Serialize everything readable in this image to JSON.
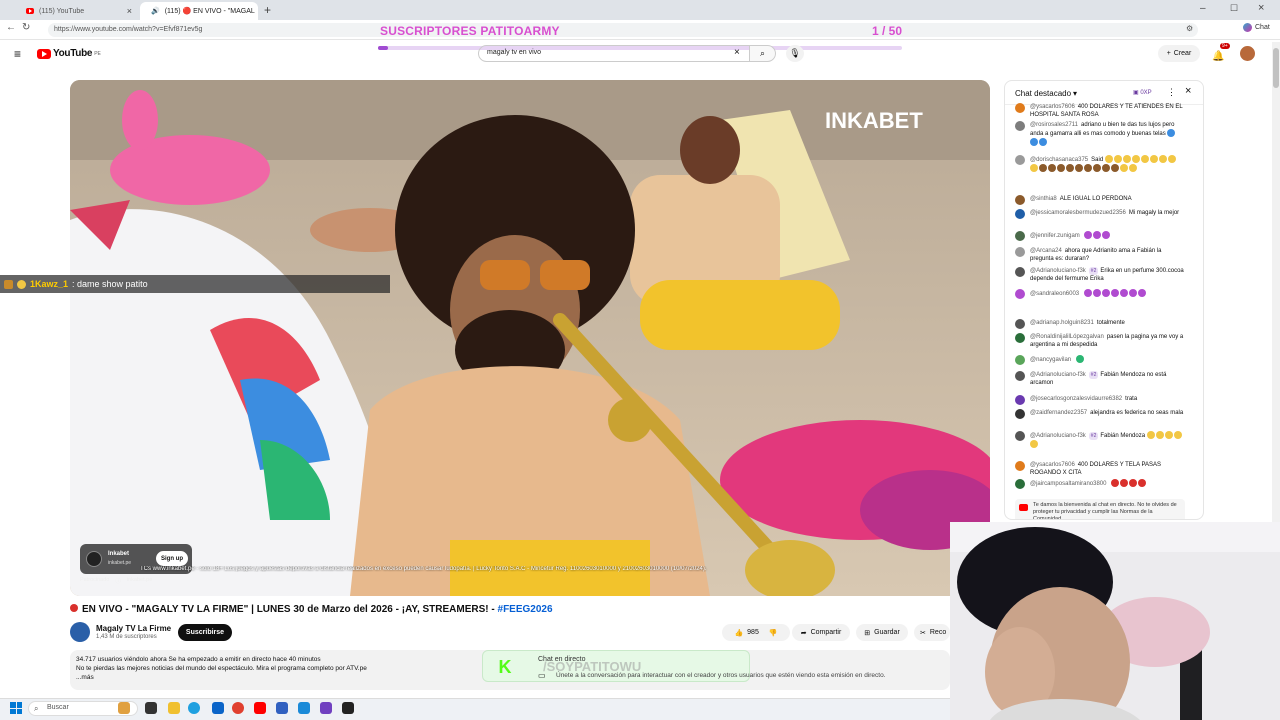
{
  "browser": {
    "tabs": [
      {
        "label": "(115) YouTube",
        "active": false
      },
      {
        "label": "(115) 🔴 EN VIVO - \"MAGAL",
        "active": true
      }
    ],
    "url": "https://www.youtube.com/watch?v=Efvf871ev5g",
    "chat_label": "Chat"
  },
  "stream_overlay": {
    "subs_text": "SUSCRIPTORES PATITOARMY",
    "counter": "1 / 50",
    "progress_fraction": 0.02,
    "chat_overlay_user": "1Kawz_1",
    "chat_overlay_text": ": dame show patito",
    "bottom_handle": "/SOYPATITOWU",
    "colors": {
      "overlay_pink": "#d84fd0",
      "progress": "#a04bd2"
    }
  },
  "youtube": {
    "logo": "YouTube",
    "country": "PE",
    "search_value": "magaly tv en vivo",
    "create_label": "Crear",
    "notif_count": "9+",
    "video": {
      "brand": "INKABET",
      "ad_name": "Inkabet",
      "ad_domain": "inkabet.pe",
      "ad_signup": "Sign up",
      "sponsored": "Patrocinado",
      "sponsored_domain": "inkabet.pe",
      "disclaimer": "TCs www.inkabet.pe - solo 18+ Los juegos y apuestas deportivas a distancia realizados en exceso pueden causar ludopatía. | Lucky Torito S.A.C - Mincetur Reg. 11002603010000 y 21002603010000 (10/07/2024)."
    },
    "title_prefix": "EN VIVO - \"MAGALY TV LA FIRME\" | LUNES 30 de Marzo del 2026 - ¡AY, STREAMERS! - ",
    "title_tag": "#FEEG2026",
    "channel_name": "Magaly TV La Firme",
    "channel_subs": "1,43 M de suscriptores",
    "subscribe": "Suscribirse",
    "likes": "985",
    "share": "Compartir",
    "save": "Guardar",
    "clip": "Reco",
    "desc_line1": "34.717 usuarios viéndolo ahora  Se ha empezado a emitir en directo hace 40 minutos",
    "desc_line2": "No te pierdas las mejores noticias del mundo del espectáculo. Mira el programa completo por ATV.pe",
    "desc_more": "...más",
    "chat_input_title": "Chat en directo",
    "chat_input_hint": "Únete a la conversación para interactuar con el creador y otros usuarios que estén viendo esta emisión en directo.",
    "kick_letter": "K"
  },
  "chat": {
    "header": "Chat destacado",
    "points": "0XP",
    "messages": [
      {
        "author": "@ysacarlos7606",
        "text": "400 DOLARES Y TE ATIENDES EN EL HOSPITAL SANTA ROSA",
        "color": "#e07b1b",
        "emojis": ""
      },
      {
        "author": "@rosirosales2711",
        "text": "adriano u bien te das tus lujos pero anda a gamarra alli es mas comodo y buenas telas",
        "color": "#7d7d7d",
        "emojis": "ccc"
      },
      {
        "author": "@dorischasanaca375",
        "text": "Said",
        "color": "#9a9a9a",
        "emojis": "yyyyyyyyybbbbbbbbbyy"
      },
      {
        "author": "@sinthia8",
        "text": "ALE IGUAL LO PERDONA",
        "color": "#8b5a2b",
        "emojis": ""
      },
      {
        "author": "@jessicamoralesbermudezued2356",
        "text": "Mi magaly la mejor",
        "color": "#1f5ea8",
        "emojis": ""
      },
      {
        "author": "@jennifer.zunigam",
        "text": "",
        "color": "#4a6a4a",
        "emojis": "ppp"
      },
      {
        "author": "@Arcana24",
        "text": "ahora que Adrianito ama a Fabián la pregunta es: duraran?",
        "color": "#9a9a9a",
        "emojis": ""
      },
      {
        "author": "@Adrianoluciano-f3k",
        "text": "Erika en un perfume 300.cocoa depende del fermume Erika",
        "color": "#555555",
        "emojis": "",
        "badge": "#2"
      },
      {
        "author": "@sandraleon6003",
        "text": "",
        "color": "#b04bd0",
        "emojis": "ppppppp"
      },
      {
        "author": "@adrianap.holguin8231",
        "text": "totalmente",
        "color": "#555555",
        "emojis": ""
      },
      {
        "author": "@RonaldinijalilLópezgalvan",
        "text": "pasen la pagina ya me voy a argentina a mi despedida",
        "color": "#2a6e3a",
        "emojis": ""
      },
      {
        "author": "@nancygavilan",
        "text": "",
        "color": "#5aa55a",
        "emojis": "g"
      },
      {
        "author": "@Adrianoluciano-f3k",
        "text": "Fabián Mendoza no está arcamon",
        "color": "#555555",
        "emojis": "",
        "badge": "#2"
      },
      {
        "author": "@josecarlosgonzalesvidaurre6382",
        "text": "trata",
        "color": "#6a3ab0",
        "emojis": ""
      },
      {
        "author": "@zaidfernandez2357",
        "text": "alejandra es federica no seas mala",
        "color": "#333333",
        "emojis": ""
      },
      {
        "author": "@Adrianoluciano-f3k",
        "text": "Fabián Mendoza",
        "color": "#555555",
        "emojis": "yyyyy",
        "badge": "#2"
      },
      {
        "author": "@ysacarlos7606",
        "text": "400 DOLARES Y TELA PASAS ROGANDO X CITA",
        "color": "#e07b1b",
        "emojis": ""
      },
      {
        "author": "@jaircamposaltamirano3800",
        "text": "",
        "color": "#2a6e3a",
        "emojis": "rrrr"
      }
    ],
    "welcome": "Te damos la bienvenida al chat en directo. No te olvides de proteger tu privacidad y cumplir las Normas de la Comunidad."
  },
  "taskbar": {
    "search_placeholder": "Buscar"
  }
}
